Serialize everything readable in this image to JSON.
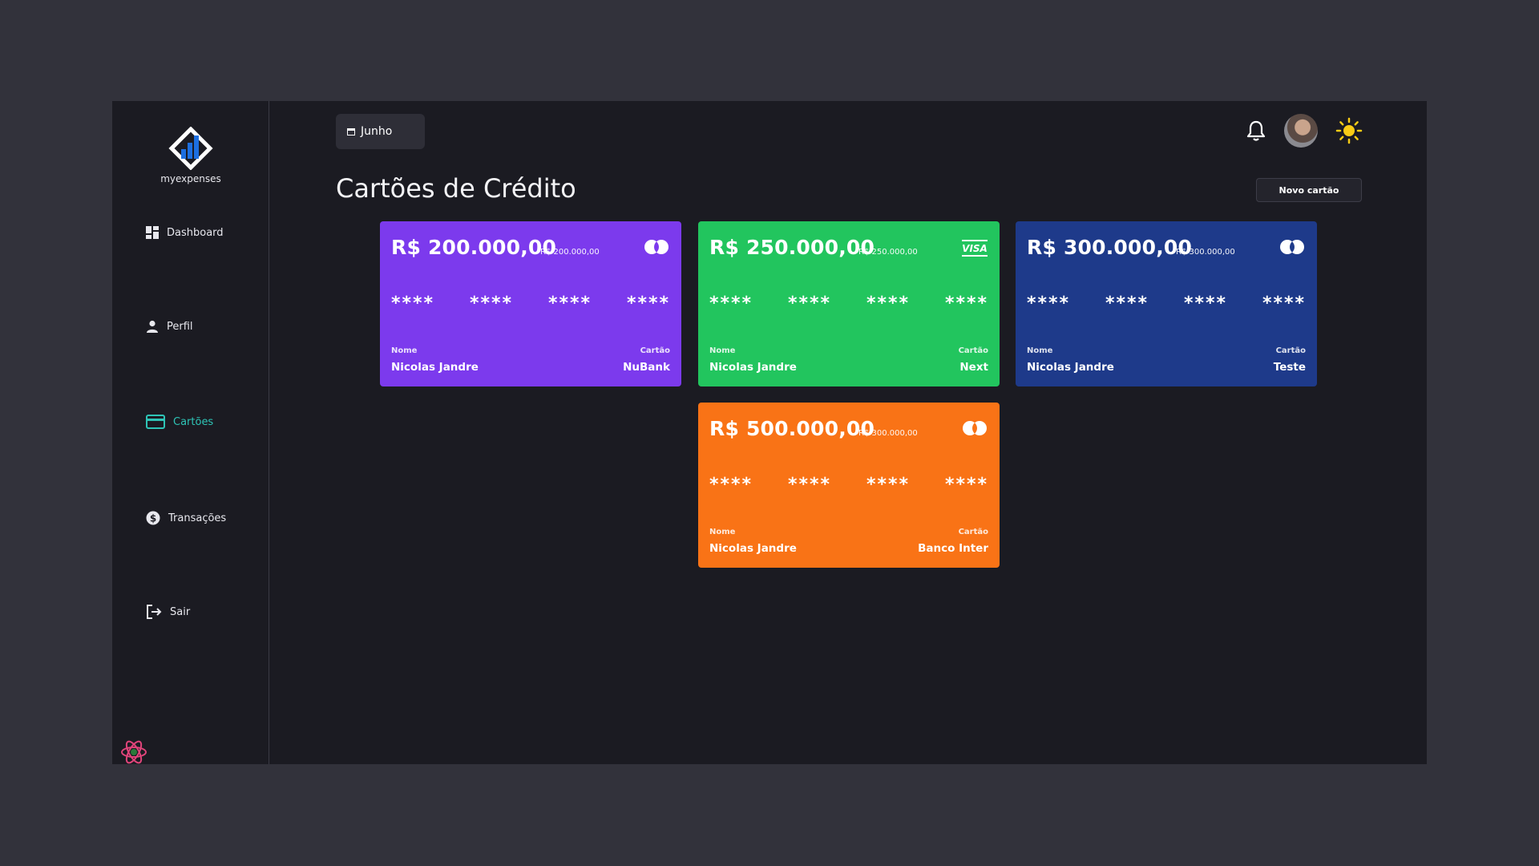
{
  "app": {
    "logo_text": "myexpenses"
  },
  "sidebar": {
    "items": [
      {
        "label": "Dashboard",
        "icon": "dashboard-icon"
      },
      {
        "label": "Perfil",
        "icon": "user-icon"
      },
      {
        "label": "Cartões",
        "icon": "credit-card-icon",
        "active": true
      },
      {
        "label": "Transações",
        "icon": "dollar-icon"
      },
      {
        "label": "Sair",
        "icon": "logout-icon"
      }
    ]
  },
  "header": {
    "month": "Junho",
    "month_icon": "calendar-icon",
    "icons": [
      "bell-icon",
      "avatar",
      "sun-icon"
    ]
  },
  "page": {
    "title": "Cartões de Crédito",
    "new_card_label": "Novo cartão"
  },
  "cards": [
    {
      "amount": "R$ 200.000,00",
      "limit": "R$ 200.000,00",
      "brand": "mastercard",
      "digits": [
        "****",
        "****",
        "****",
        "****"
      ],
      "name_label": "Nome",
      "name": "Nicolas Jandre",
      "card_label": "Cartão",
      "card": "NuBank",
      "color": "#7c3aed"
    },
    {
      "amount": "R$ 250.000,00",
      "limit": "R$ 250.000,00",
      "brand": "visa",
      "brand_text": "VISA",
      "digits": [
        "****",
        "****",
        "****",
        "****"
      ],
      "name_label": "Nome",
      "name": "Nicolas Jandre",
      "card_label": "Cartão",
      "card": "Next",
      "color": "#22c55e"
    },
    {
      "amount": "R$ 300.000,00",
      "limit": "R$ 300.000,00",
      "brand": "mastercard",
      "digits": [
        "****",
        "****",
        "****",
        "****"
      ],
      "name_label": "Nome",
      "name": "Nicolas Jandre",
      "card_label": "Cartão",
      "card": "Teste",
      "color": "#1e3a8a"
    },
    {
      "amount": "R$ 500.000,00",
      "limit": "R$ 300.000,00",
      "brand": "mastercard",
      "digits": [
        "****",
        "****",
        "****",
        "****"
      ],
      "name_label": "Nome",
      "name": "Nicolas Jandre",
      "card_label": "Cartão",
      "card": "Banco Inter",
      "color": "#f97316"
    }
  ],
  "colors": {
    "background": "#32323b",
    "app_bg": "#1b1b22",
    "accent_active": "#2ec4b6",
    "sun": "#facc15"
  }
}
